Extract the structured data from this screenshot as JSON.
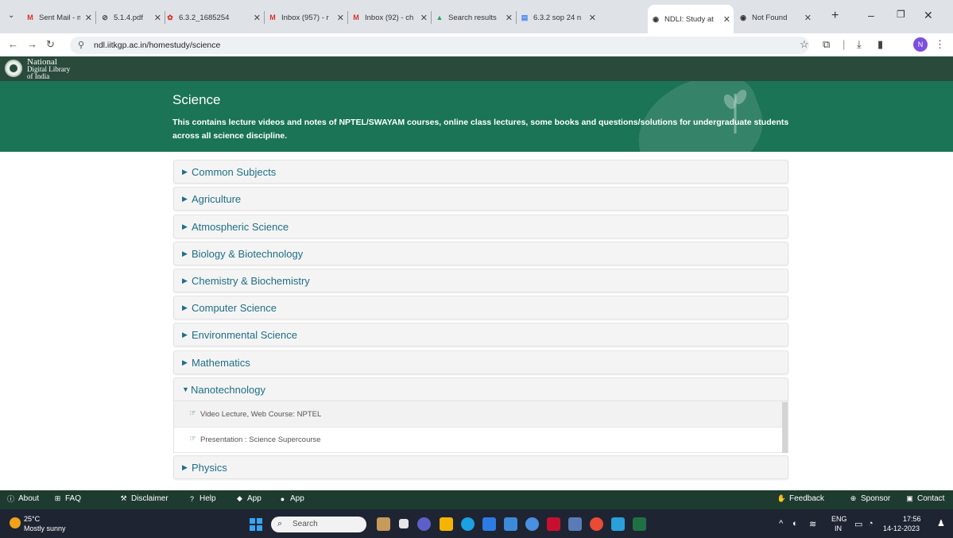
{
  "browser": {
    "tabs": [
      {
        "title": "Sent Mail - mo",
        "icon": "gmail-icon",
        "color": "#d93025",
        "glyph": "M"
      },
      {
        "title": "5.1.4.pdf",
        "icon": "globe-icon",
        "color": "#444444",
        "glyph": "⊘"
      },
      {
        "title": "6.3.2_1685254",
        "icon": "pdf-icon",
        "color": "#d93025",
        "glyph": "✿"
      },
      {
        "title": "Inbox (957) - r",
        "icon": "gmail-icon",
        "color": "#d93025",
        "glyph": "M"
      },
      {
        "title": "Inbox (92) - ch",
        "icon": "gmail-icon",
        "color": "#d93025",
        "glyph": "M"
      },
      {
        "title": "Search results",
        "icon": "drive-icon",
        "color": "#1fa463",
        "glyph": "▲"
      },
      {
        "title": "6.3.2 sop 24 n",
        "icon": "docs-icon",
        "color": "#4285f4",
        "glyph": "▤"
      },
      {
        "title": "NDLI: Study at",
        "icon": "globe-icon",
        "color": "#333333",
        "glyph": "◉",
        "active": true
      },
      {
        "title": "Not Found",
        "icon": "globe-icon",
        "color": "#333333",
        "glyph": "◉"
      }
    ],
    "url": "ndl.iitkgp.ac.in/homestudy/science",
    "profile_initial": "N"
  },
  "site": {
    "logo_line1": "National",
    "logo_line2": "Digital Library",
    "logo_line3": "of India",
    "page_title": "Science",
    "description": "This contains lecture videos and notes of NPTEL/SWAYAM courses, online class lectures, some books and questions/solutions for undergraduate students across all science discipline."
  },
  "subjects": [
    {
      "label": "Common Subjects",
      "expanded": false
    },
    {
      "label": "Agriculture",
      "expanded": false
    },
    {
      "label": "Atmospheric Science",
      "expanded": false
    },
    {
      "label": "Biology & Biotechnology",
      "expanded": false
    },
    {
      "label": "Chemistry & Biochemistry",
      "expanded": false
    },
    {
      "label": "Computer Science",
      "expanded": false
    },
    {
      "label": "Environmental Science",
      "expanded": false
    },
    {
      "label": "Mathematics",
      "expanded": false
    },
    {
      "label": "Nanotechnology",
      "expanded": true
    },
    {
      "label": "Physics",
      "expanded": false
    }
  ],
  "expanded_items": [
    {
      "label": "Video Lecture, Web Course: NPTEL"
    },
    {
      "label": "Presentation : Science Supercourse"
    }
  ],
  "footer": {
    "left": [
      {
        "label": "About",
        "icon": "info-icon"
      },
      {
        "label": "FAQ",
        "icon": "sitemap-icon"
      },
      {
        "label": "Disclaimer",
        "icon": "gavel-icon"
      },
      {
        "label": "Help",
        "icon": "question-icon"
      },
      {
        "label": "App",
        "icon": "android-icon"
      },
      {
        "label": "App",
        "icon": "apple-icon"
      }
    ],
    "right": [
      {
        "label": "Feedback",
        "icon": "feedback-icon"
      },
      {
        "label": "Sponsor",
        "icon": "sponsor-icon"
      },
      {
        "label": "Contact",
        "icon": "contact-icon"
      }
    ]
  },
  "taskbar": {
    "temperature": "25°C",
    "weather": "Mostly sunny",
    "search_placeholder": "Search",
    "lang_top": "ENG",
    "lang_bottom": "IN",
    "time": "17:56",
    "date": "14-12-2023"
  },
  "colors": {
    "header_dark": "#2a4a3c",
    "hero_green": "#1a7455",
    "link_teal": "#1f6f86",
    "footer_dark": "#1d3b2e"
  }
}
